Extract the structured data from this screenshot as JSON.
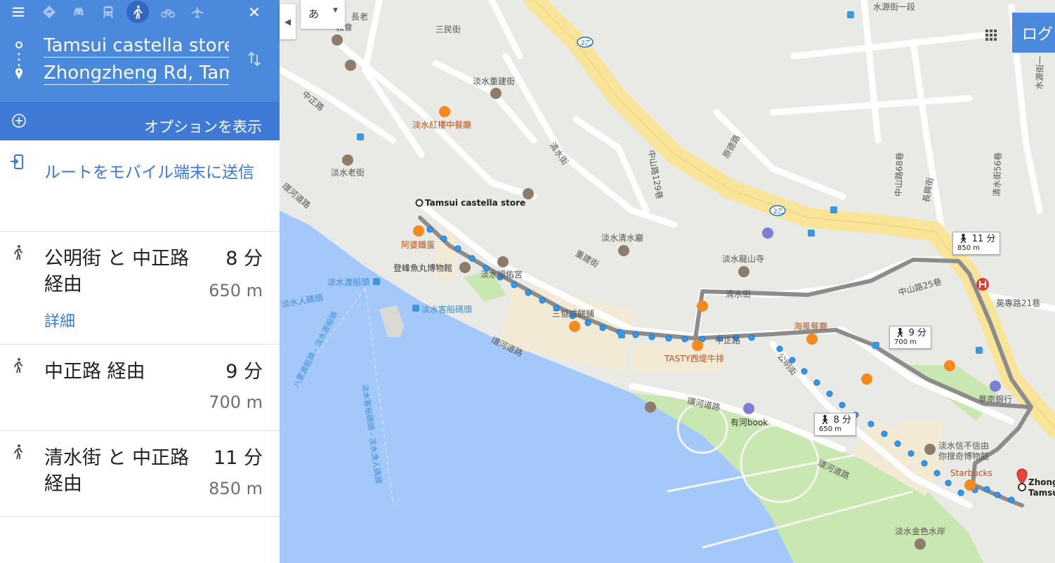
{
  "panel": {
    "origin": "Tamsui castella store",
    "destination": "Zhongzheng Rd, Tamsui",
    "options_label": "オプションを表示",
    "send_to_mobile": "ルートをモバイル端末に送信",
    "routes": [
      {
        "title": "公明街 と 中正路 経由",
        "time": "8 分",
        "distance": "650 m",
        "detail": "詳細"
      },
      {
        "title": "中正路 経由",
        "time": "9 分",
        "distance": "700 m"
      },
      {
        "title": "清水街 と 中正路 経由",
        "time": "11 分",
        "distance": "850 m"
      }
    ]
  },
  "map": {
    "ime_label": "あ",
    "login_label": "ログ",
    "start_label": "Tamsui castella store",
    "end_label_line1": "Zhong",
    "end_label_line2": "Tamsu",
    "callouts": [
      {
        "time": "11 分",
        "distance": "850 m"
      },
      {
        "time": "9 分",
        "distance": "700 m"
      },
      {
        "time": "8 分",
        "distance": "650 m"
      }
    ],
    "labels": {
      "sanmin": "三民街",
      "chongjian1": "淡水重建街",
      "church1": "長老",
      "church2": "教會",
      "zhongzheng_nw": "中正路",
      "hongloudining": "淡水紅樓中餐廳",
      "qingshui_st": "清水街",
      "zhongshan129": "中山路129巷",
      "yuande": "原德路",
      "laojie": "淡水老街",
      "huanhe1": "環河道路",
      "agei": "阿婆鐵蛋",
      "dengfeng": "登峰魚丸博物館",
      "fuyou": "淡水福佑宮",
      "qingshuiyan": "淡水清水巖",
      "chongjian2": "重建街",
      "longshan": "淡水龍山寺",
      "ferry": "淡水渡船頭",
      "pier": "淡水客船碼頭",
      "yurenmatou": "淡水人碼頭",
      "sanxie": "三協成餅鋪",
      "qingshui2": "清水街",
      "zhongshan25": "中山路25巷",
      "haifeng": "海風餐廳",
      "zhongzheng_main": "中正路",
      "tasty": "TASTY西堤牛排",
      "huanhe2": "環河道路",
      "gongming": "公明街",
      "huanhe3": "環河道路",
      "youhebook": "有河book",
      "huanhe4": "環河道路",
      "xinbuxin": "淡水信不信由",
      "xinbuxin2": "你搜奇博物館",
      "starbucks": "Starbucks",
      "huanan": "華南銀行",
      "yingzhuan": "英專路21巷",
      "shuiyuan": "水源街一段",
      "zhongshan68": "中山路68巷",
      "changxing": "長興街",
      "qingshui56": "清水街56巷",
      "shuiyuanjie": "水源街一",
      "jinsewater": "淡水金色水岸",
      "ferryroute1": "八里渡船頭 - 淡水渡船頭",
      "ferryroute2": "淡水客船碼頭 - 淡水漁人碼頭",
      "road2": "2乙"
    }
  },
  "colors": {
    "header_blue": "#4a89dc",
    "route_blue": "#3b78d8",
    "water": "#a5c8fb",
    "road_yellow": "#f8e59a",
    "park_green": "#c9e7b0"
  }
}
